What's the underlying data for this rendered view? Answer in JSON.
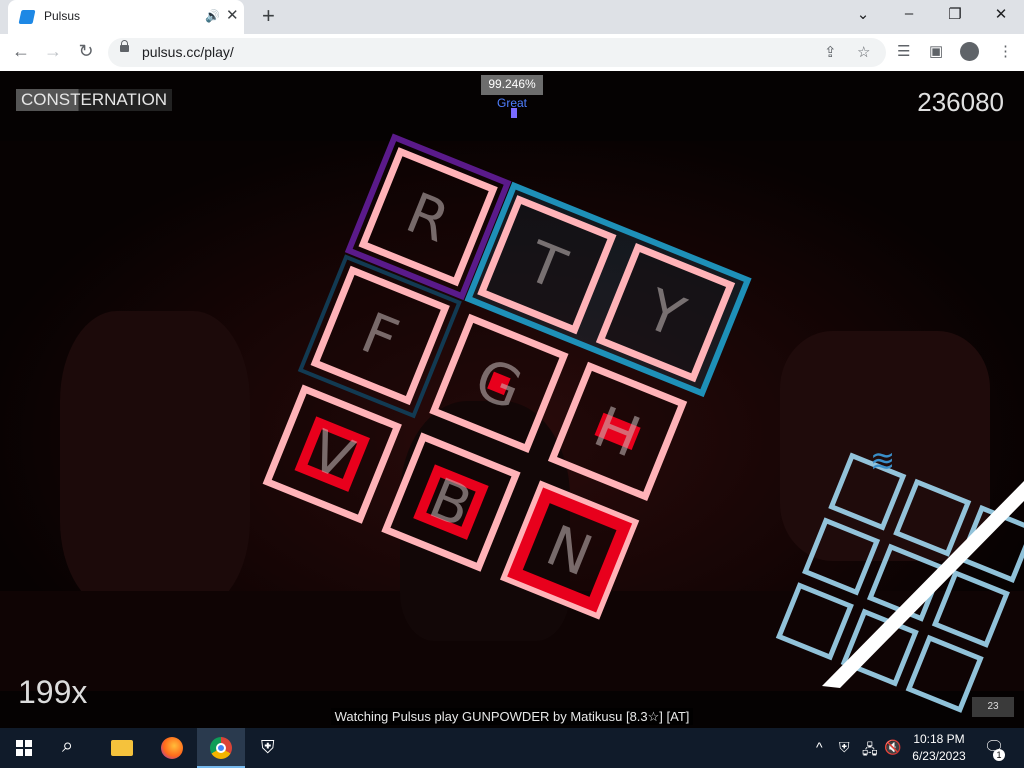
{
  "browser": {
    "tab": {
      "title": "Pulsus",
      "favicon": "pulsus-favicon"
    },
    "url": "pulsus.cc/play/"
  },
  "game": {
    "song_title": "CONSTERNATION",
    "accuracy": "99.246%",
    "accuracy_fraction": 0.99246,
    "judgement": "Great",
    "score": "236080",
    "combo": "199x",
    "watching": "Watching Pulsus play GUNPOWDER by Matikusu [8.3☆] [AT]",
    "counter": "23",
    "keys": [
      "R",
      "T",
      "Y",
      "F",
      "G",
      "H",
      "V",
      "B",
      "N"
    ],
    "colors": {
      "tile": "#ffb3b8",
      "note": "#e8001c",
      "purple": "#5a1a8a",
      "blue": "#1e90b8",
      "ghost": "#a8e4ff"
    }
  },
  "taskbar": {
    "time": "10:18 PM",
    "date": "6/23/2023",
    "notification_count": "1"
  }
}
